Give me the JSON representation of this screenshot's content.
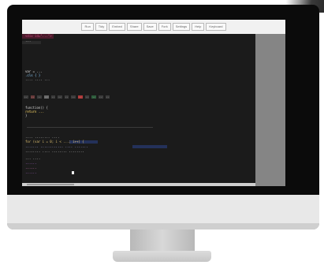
{
  "toolbar": {
    "buttons": [
      {
        "label": "Run"
      },
      {
        "label": "Tidy"
      },
      {
        "label": "Embed"
      },
      {
        "label": "Share"
      },
      {
        "label": "Save"
      },
      {
        "label": "Fork"
      },
      {
        "label": "Settings"
      },
      {
        "label": "Help"
      },
      {
        "label": "Keyboard"
      }
    ]
  },
  "editor": {
    "lines": [
      {
        "text": "<div id=\"...\">",
        "color": "#c7437a"
      },
      {
        "text": "  ...",
        "color": "#d8d8d8"
      },
      {
        "text": "var = ...",
        "color": "#e0e0e0"
      },
      {
        "text": "  .cls { }",
        "color": "#8fd0ff"
      },
      {
        "text": "  .... .... ...",
        "color": "#d6d6d6"
      },
      {
        "text": "function() {",
        "color": "#d6d6d6"
      },
      {
        "text": "  return ...",
        "color": "#ffd866"
      },
      {
        "text": "}",
        "color": "#d6d6d6"
      },
      {
        "text": "  ....  ........ ....",
        "color": "#d6d6d6"
      },
      {
        "text": "for (var i = 0; i < ...; i++) {",
        "color": "#e0c070"
      },
      {
        "text": "  ....... ............ .... .......",
        "color": "#b8b8ff"
      },
      {
        "text": "  ........ .... ........ ........",
        "color": "#e0e0e0"
      },
      {
        "text": "    ... ....",
        "color": "#d6d6d6"
      },
      {
        "text": "      ......",
        "color": "#d07cff"
      },
      {
        "text": "      ......",
        "color": "#ff8ad8"
      },
      {
        "text": "      ......",
        "color": "#d07cff"
      }
    ]
  },
  "segments": [
    {
      "text": "..",
      "color": "#3c3c3c"
    },
    {
      "text": "..",
      "color": "#6a3b3b"
    },
    {
      "text": "..",
      "color": "#3c3c3c"
    },
    {
      "text": "..",
      "color": "#6b6b6b"
    },
    {
      "text": "..",
      "color": "#3c3c3c"
    },
    {
      "text": "..",
      "color": "#3c3c3c"
    },
    {
      "text": "..",
      "color": "#3c3c3c"
    },
    {
      "text": "..",
      "color": "#3c3c3c"
    },
    {
      "text": "..",
      "color": "#b03a3a"
    },
    {
      "text": "..",
      "color": "#3c3c3c"
    },
    {
      "text": "..",
      "color": "#2e5d3c"
    },
    {
      "text": "..",
      "color": "#3c3c3c"
    },
    {
      "text": "..",
      "color": "#3c3c3c"
    }
  ]
}
